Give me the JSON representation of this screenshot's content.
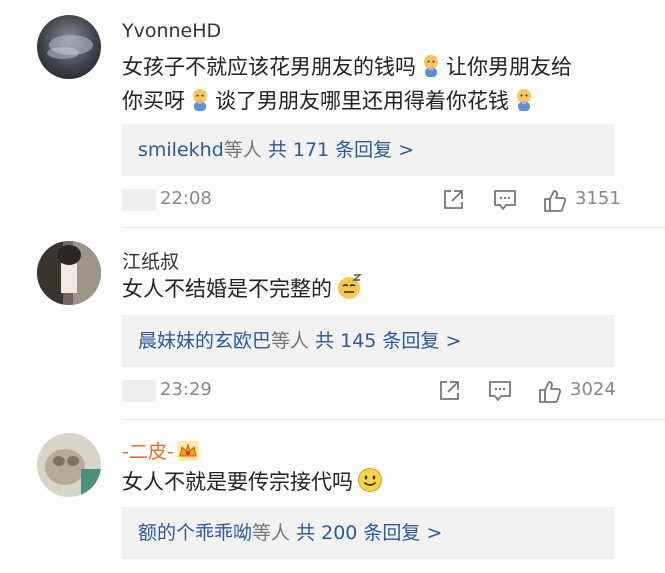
{
  "comments": [
    {
      "username": "YvonneHD",
      "text_line1": "女孩子不就应该花男朋友的钱吗",
      "text_line2a": "让你男朋友给",
      "text_line2b": "你买呀",
      "text_line3": "谈了男朋友哪里还用得着你花钱",
      "reply_users": "smilekhd",
      "reply_mid": "等人",
      "reply_summary": "共 171 条回复 >",
      "time": "22:08",
      "likes": "3151",
      "emoji": "baby-bottle-emoji"
    },
    {
      "username": "江纸叔",
      "text": "女人不结婚是不完整的",
      "reply_users": "晨妹妹的玄欧巴",
      "reply_mid": "等人",
      "reply_summary": "共 145 条回复 >",
      "time": "23:29",
      "likes": "3024",
      "emoji": "sleepy-smirk-emoji"
    },
    {
      "username": "-二皮-",
      "text": "女人不就是要传宗接代吗",
      "reply_users": "额的个乖乖呦",
      "reply_mid": "等人",
      "reply_summary": "共 200 条回复 >",
      "emoji": "smile-emoji",
      "badge": "crown-badge-icon"
    }
  ],
  "colors": {
    "link": "#2a5a9b",
    "vip_name": "#f26a1b",
    "reply_bg": "#f2f2f2",
    "meta_gray": "#888888"
  }
}
